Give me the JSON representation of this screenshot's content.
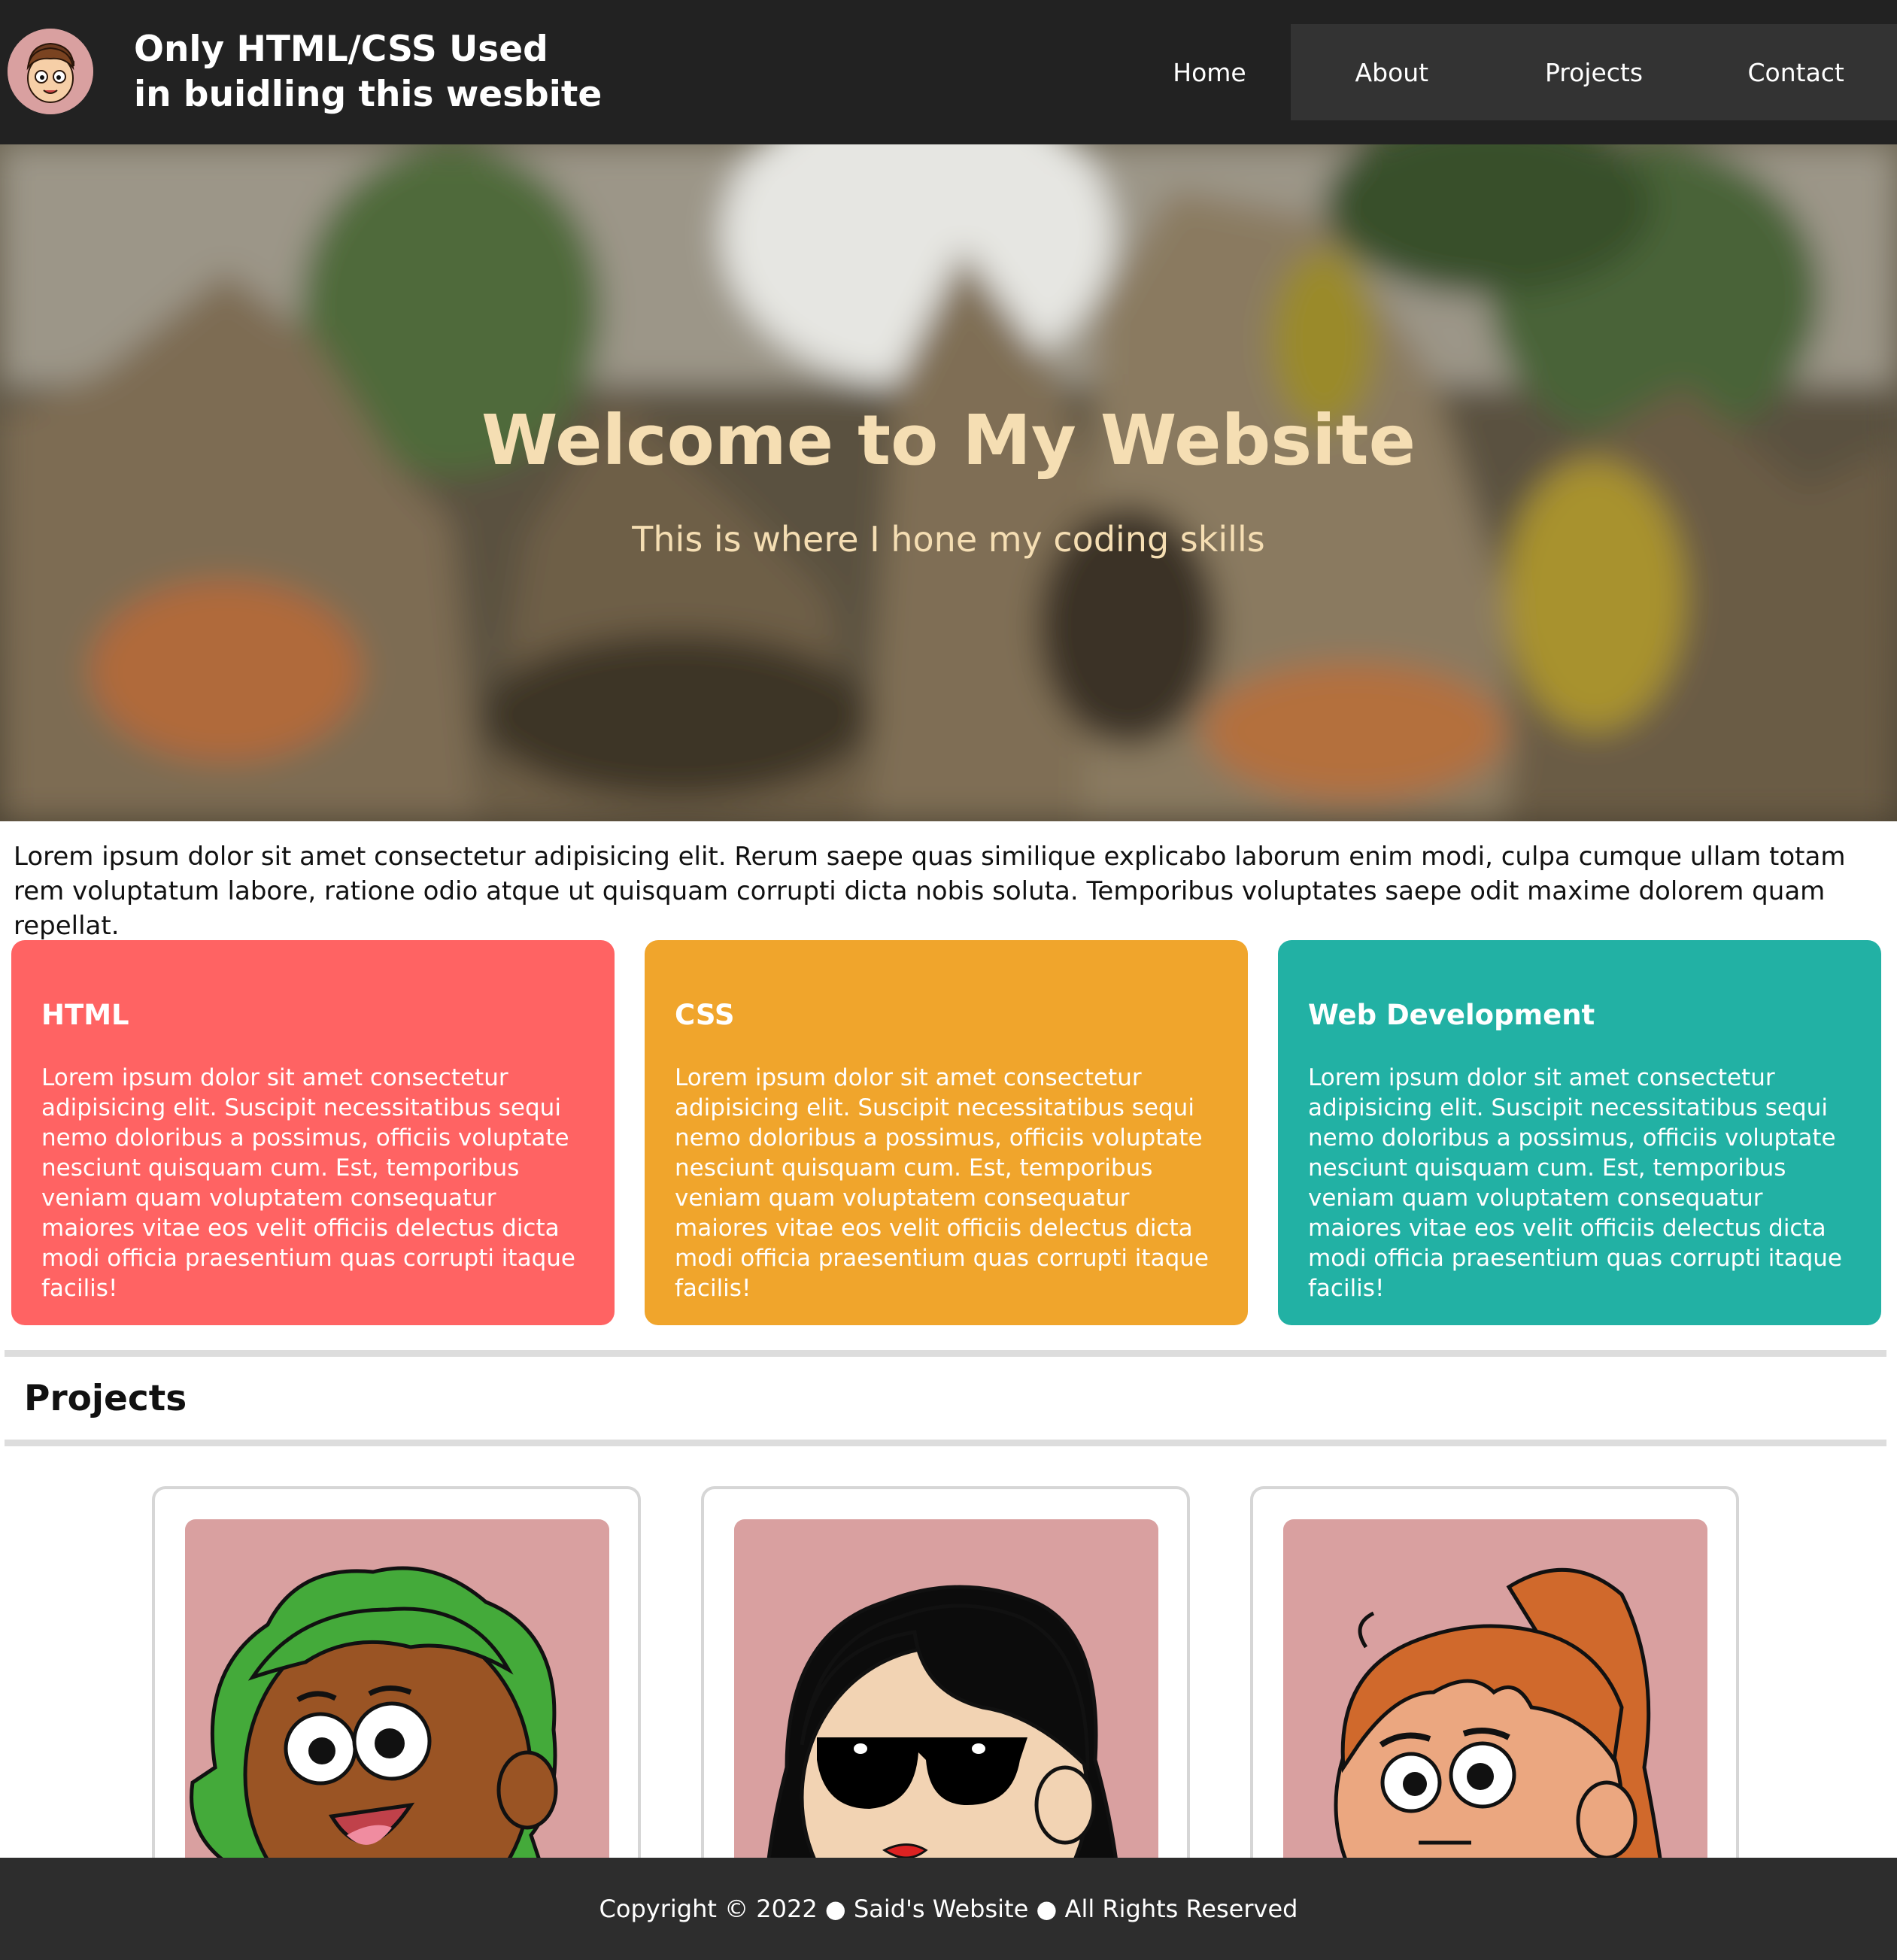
{
  "header": {
    "title_line1": "Only HTML/CSS Used",
    "title_line2": "in buidling this wesbite",
    "logo_icon": "cartoon-avatar-icon"
  },
  "nav": {
    "items": [
      {
        "label": "Home"
      },
      {
        "label": "About"
      },
      {
        "label": "Projects"
      },
      {
        "label": "Contact"
      }
    ]
  },
  "hero": {
    "title": "Welcome to My Website",
    "subtitle": "This is where I hone my coding skills"
  },
  "intro": {
    "text": "Lorem ipsum dolor sit amet consectetur adipisicing elit. Rerum saepe quas similique explicabo laborum enim modi, culpa cumque ullam totam rem voluptatum labore, ratione odio atque ut quisquam corrupti dicta nobis soluta. Temporibus voluptates saepe odit maxime dolorem quam repellat."
  },
  "features": [
    {
      "title": "HTML",
      "body": "Lorem ipsum dolor sit amet consectetur adipisicing elit. Suscipit necessitatibus sequi nemo doloribus a possimus, officiis voluptate nesciunt quisquam cum. Est, temporibus veniam quam voluptatem consequatur maiores vitae eos velit officiis delectus dicta modi officia praesentium quas corrupti itaque facilis!",
      "color": "#ff6363"
    },
    {
      "title": "CSS",
      "body": "Lorem ipsum dolor sit amet consectetur adipisicing elit. Suscipit necessitatibus sequi nemo doloribus a possimus, officiis voluptate nesciunt quisquam cum. Est, temporibus veniam quam voluptatem consequatur maiores vitae eos velit officiis delectus dicta modi officia praesentium quas corrupti itaque facilis!",
      "color": "#f0a52c"
    },
    {
      "title": "Web Development",
      "body": "Lorem ipsum dolor sit amet consectetur adipisicing elit. Suscipit necessitatibus sequi nemo doloribus a possimus, officiis voluptate nesciunt quisquam cum. Est, temporibus veniam quam voluptatem consequatur maiores vitae eos velit officiis delectus dicta modi officia praesentium quas corrupti itaque facilis!",
      "color": "#22b1a4"
    }
  ],
  "projects": {
    "heading": "Projects",
    "cards": [
      {
        "icon": "green-hair-avatar-icon"
      },
      {
        "icon": "sunglasses-avatar-icon"
      },
      {
        "icon": "orange-hair-avatar-icon"
      }
    ]
  },
  "footer": {
    "text": "Copyright © 2022 ● Said's Website ● All Rights Reserved"
  },
  "colors": {
    "header_bg": "#222222",
    "nav_group_bg": "#333333",
    "hero_text": "#f5deb3",
    "avatar_bg": "#d9a0a0",
    "footer_bg": "#2d2d2d"
  }
}
